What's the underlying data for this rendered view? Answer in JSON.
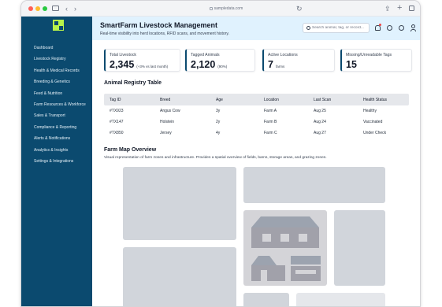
{
  "browser": {
    "url": "sampledata.com"
  },
  "sidebar": {
    "items": [
      {
        "label": "Dashboard"
      },
      {
        "label": "Livestock Registry"
      },
      {
        "label": "Health & Medical Records"
      },
      {
        "label": "Breeding & Genetics"
      },
      {
        "label": "Feed & Nutrition"
      },
      {
        "label": "Farm Resources & Workforce"
      },
      {
        "label": "Sales & Transport"
      },
      {
        "label": "Compliance & Reporting"
      },
      {
        "label": "Alerts & Notifications"
      },
      {
        "label": "Analytics & Insights"
      },
      {
        "label": "Settings & Integrations"
      }
    ]
  },
  "header": {
    "title": "SmartFarm Livestock Management",
    "subtitle": "Real-time visibility into herd locations, RFID scans, and movement history.",
    "search_placeholder": "Search animal, tag, or record..."
  },
  "stats": [
    {
      "label": "Total Livestock",
      "value": "2,345",
      "note": "(+3% vs last month)"
    },
    {
      "label": "Tagged Animals",
      "value": "2,120",
      "note": "(90%)"
    },
    {
      "label": "Active Locations",
      "value": "7",
      "note": "farms"
    },
    {
      "label": "Missing/Unreadable Tags",
      "value": "15",
      "note": ""
    }
  ],
  "registry": {
    "title": "Animal Registry Table",
    "columns": [
      "Tag ID",
      "Breed",
      "Age",
      "Location",
      "Last Scan",
      "Health Status"
    ],
    "rows": [
      [
        "#TX923",
        "Angus Cow",
        "3y",
        "Farm A",
        "Aug 25",
        "Healthy"
      ],
      [
        "#TX147",
        "Holstein",
        "2y",
        "Farm B",
        "Aug 24",
        "Vaccinated"
      ],
      [
        "#TX850",
        "Jersey",
        "4y",
        "Farm C",
        "Aug 27",
        "Under Check"
      ]
    ]
  },
  "map": {
    "title": "Farm Map Overview",
    "description": "Visual representation of farm zones and infrastructure. Provides a spatial overview of fields, barns, storage areas, and grazing zones."
  },
  "colors": {
    "sidebar": "#0b4a6f",
    "header": "#e0f2fe",
    "logo": "#b8f34a",
    "placeholder": "#d1d5db"
  }
}
